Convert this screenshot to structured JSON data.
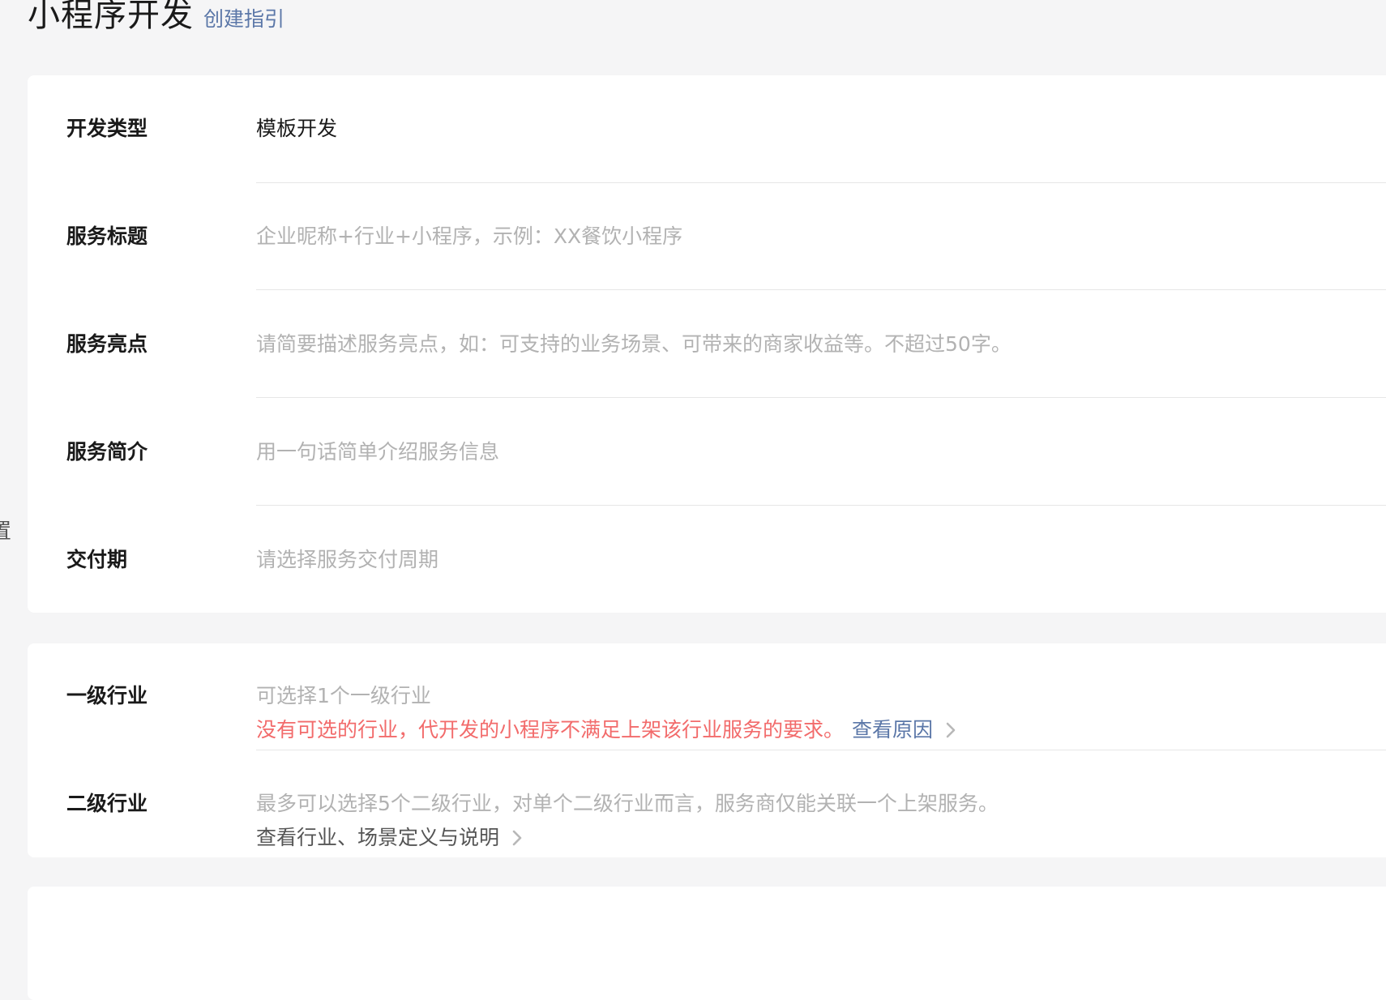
{
  "header": {
    "title": "小程序开发",
    "guide_link": "创建指引"
  },
  "sidebar_fragment": "置",
  "basic_info": {
    "dev_type": {
      "label": "开发类型",
      "value": "模板开发"
    },
    "service_title": {
      "label": "服务标题",
      "placeholder": "企业昵称+行业+小程序，示例：XX餐饮小程序"
    },
    "service_highlight": {
      "label": "服务亮点",
      "placeholder": "请简要描述服务亮点，如：可支持的业务场景、可带来的商家收益等。不超过50字。"
    },
    "service_intro": {
      "label": "服务简介",
      "placeholder": "用一句话简单介绍服务信息"
    },
    "delivery_period": {
      "label": "交付期",
      "placeholder": "请选择服务交付周期"
    }
  },
  "industry": {
    "level1": {
      "label": "一级行业",
      "placeholder": "可选择1个一级行业",
      "warning": "没有可选的行业，代开发的小程序不满足上架该行业服务的要求。",
      "reason_link": "查看原因"
    },
    "level2": {
      "label": "二级行业",
      "hint": "最多可以选择5个二级行业，对单个二级行业而言，服务商仅能关联一个上架服务。",
      "definition_link": "查看行业、场景定义与说明"
    }
  },
  "icons": {
    "chevron_right": "chevron-right-icon"
  },
  "colors": {
    "link": "#5b77a8",
    "warning": "#f26b6b",
    "placeholder": "#b2b2b2"
  }
}
